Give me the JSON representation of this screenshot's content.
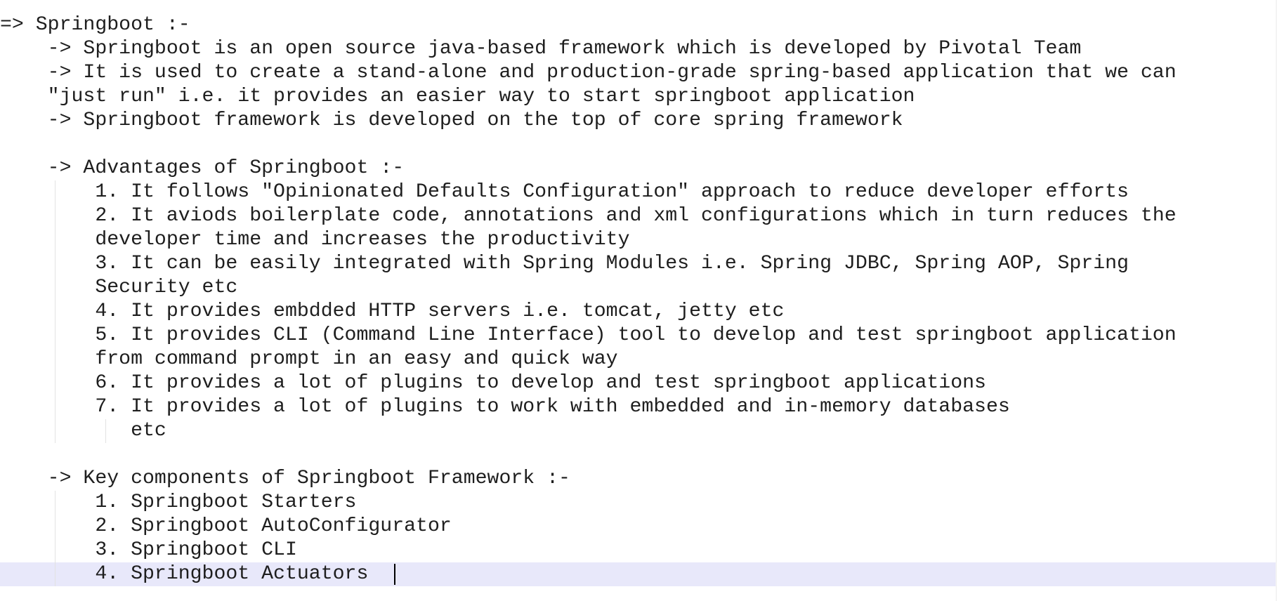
{
  "editor": {
    "lines": [
      "=> Springboot :-",
      "    -> Springboot is an open source java-based framework which is developed by Pivotal Team",
      "    -> It is used to create a stand-alone and production-grade spring-based application that we can",
      "    \"just run\" i.e. it provides an easier way to start springboot application",
      "    -> Springboot framework is developed on the top of core spring framework",
      "",
      "    -> Advantages of Springboot :-",
      "        1. It follows \"Opinionated Defaults Configuration\" approach to reduce developer efforts",
      "        2. It aviods boilerplate code, annotations and xml configurations which in turn reduces the",
      "        developer time and increases the productivity",
      "        3. It can be easily integrated with Spring Modules i.e. Spring JDBC, Spring AOP, Spring",
      "        Security etc",
      "        4. It provides embdded HTTP servers i.e. tomcat, jetty etc",
      "        5. It provides CLI (Command Line Interface) tool to develop and test springboot application",
      "        from command prompt in an easy and quick way",
      "        6. It provides a lot of plugins to develop and test springboot applications",
      "        7. It provides a lot of plugins to work with embedded and in-memory databases",
      "           etc",
      "",
      "    -> Key components of Springboot Framework :-",
      "        1. Springboot Starters",
      "        2. Springboot AutoConfigurator",
      "        3. Springboot CLI",
      "        4. Springboot Actuators"
    ]
  }
}
